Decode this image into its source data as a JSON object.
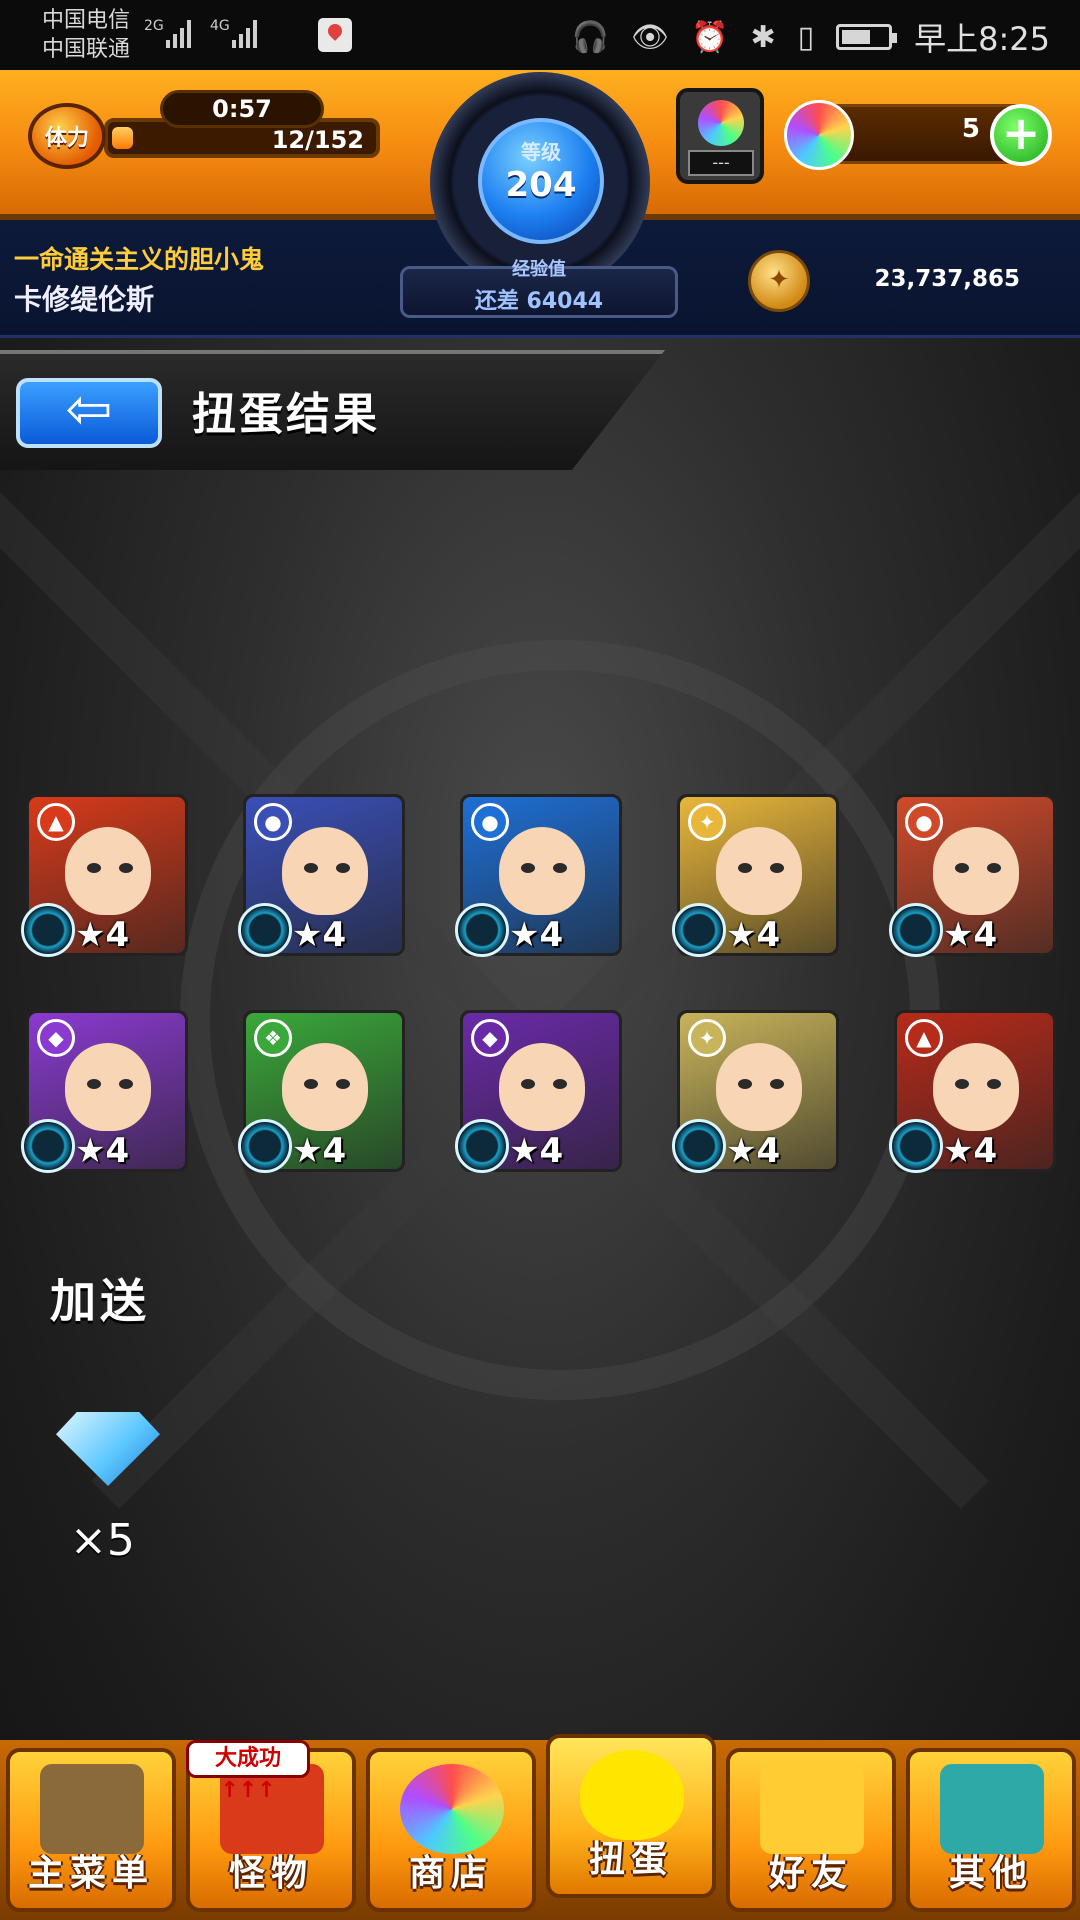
{
  "status_bar": {
    "carrier_1": "中国电信",
    "carrier_2": "中国联通",
    "net_1": "2G",
    "net_2": "4G",
    "time": "早上8:25"
  },
  "header": {
    "stamina_badge": "体力",
    "stamina_timer": "0:57",
    "stamina_value": "12/152",
    "stamina_fraction": 0.079,
    "level_label": "等级",
    "level_value": "204",
    "exp_caption": "经验值",
    "exp_remaining": "还差 64044",
    "ticket_value": "---",
    "orb_count": "5",
    "plus_label": "+",
    "player_title": "一命通关主义的胆小鬼",
    "player_name": "卡修缇伦斯",
    "gold_amount": "23,737,865"
  },
  "page": {
    "back_label": "⇦",
    "title": "扭蛋结果"
  },
  "results": [
    {
      "rarity": "★4",
      "element": "fire",
      "color": "#d83a1a",
      "attr_icon": "fire-icon"
    },
    {
      "rarity": "★4",
      "element": "water",
      "color": "#3a4fb8",
      "attr_icon": "water-icon"
    },
    {
      "rarity": "★4",
      "element": "water",
      "color": "#1e6fd6",
      "attr_icon": "water-icon"
    },
    {
      "rarity": "★4",
      "element": "light",
      "color": "#e8b63a",
      "attr_icon": "light-icon"
    },
    {
      "rarity": "★4",
      "element": "water",
      "color": "#d04a2a",
      "attr_icon": "water-icon"
    },
    {
      "rarity": "★4",
      "element": "dark",
      "color": "#8a3ad0",
      "attr_icon": "dark-icon"
    },
    {
      "rarity": "★4",
      "element": "wood",
      "color": "#3aa83a",
      "attr_icon": "wood-icon"
    },
    {
      "rarity": "★4",
      "element": "dark",
      "color": "#6a2aa8",
      "attr_icon": "dark-icon"
    },
    {
      "rarity": "★4",
      "element": "light",
      "color": "#c8b45a",
      "attr_icon": "light-icon"
    },
    {
      "rarity": "★4",
      "element": "fire",
      "color": "#b82a1a",
      "attr_icon": "fire-icon"
    }
  ],
  "bonus": {
    "label": "加送",
    "item_icon": "diamond-icon",
    "count": "×5"
  },
  "nav": {
    "bubble": "大成功↑↑↑",
    "items": [
      {
        "label": "主菜单",
        "icon": "gate-icon"
      },
      {
        "label": "怪物",
        "icon": "dragon-icon"
      },
      {
        "label": "商店",
        "icon": "rainbow-orb-icon"
      },
      {
        "label": "扭蛋",
        "icon": "egg-icon"
      },
      {
        "label": "好友",
        "icon": "balloon-icon"
      },
      {
        "label": "其他",
        "icon": "question-icon"
      }
    ]
  }
}
